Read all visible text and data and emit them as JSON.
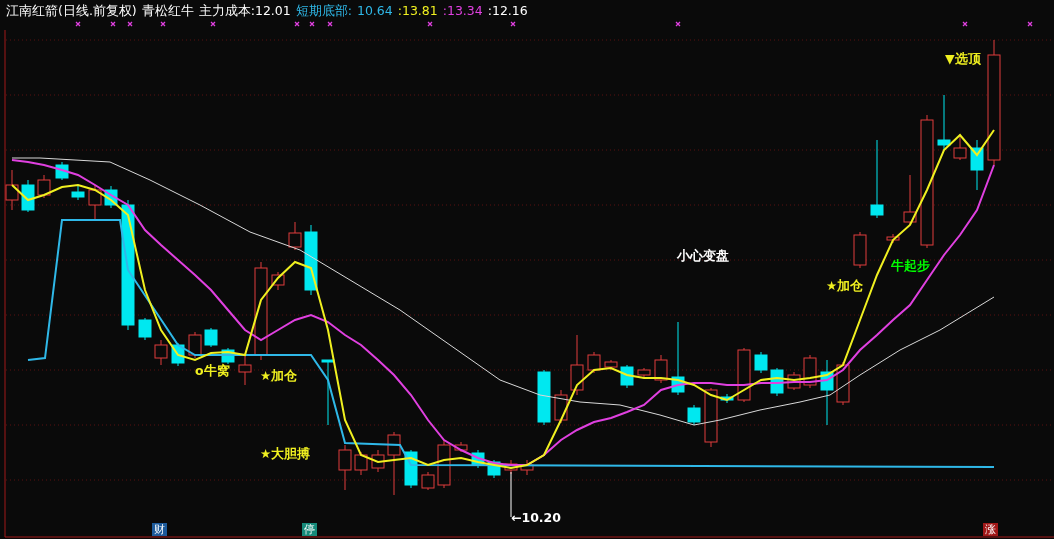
{
  "header": {
    "items": [
      {
        "text": "江南红箭(日线.前复权)",
        "color": "#ffffff"
      },
      {
        "text": "青松红牛",
        "color": "#ffffff"
      },
      {
        "text": "主力成本:12.01",
        "color": "#ffffff"
      },
      {
        "text": "短期底部:",
        "color": "#2fb8e8"
      },
      {
        "text": "10.64",
        "color": "#2fb8e8"
      },
      {
        "text": ":13.81",
        "color": "#f0f020"
      },
      {
        "text": ":13.34",
        "color": "#e040e0"
      },
      {
        "text": ":12.16",
        "color": "#ffffff"
      }
    ]
  },
  "annotations": [
    {
      "text": "o牛窝",
      "color": "#f0f020"
    },
    {
      "text": "★加仓",
      "color": "#f0f020"
    },
    {
      "text": "★大胆搏",
      "color": "#f0f020"
    },
    {
      "text": "小心变盘",
      "color": "#ffffff"
    },
    {
      "text": "★加仓",
      "color": "#f0f020"
    },
    {
      "text": "牛起步",
      "color": "#00ff00"
    },
    {
      "text": "▼选顶",
      "color": "#f0f020"
    },
    {
      "text": "←10.20",
      "color": "#ffffff"
    }
  ],
  "badges": [
    {
      "text": "财",
      "color": "#1d5a9a"
    },
    {
      "text": "停",
      "color": "#168a7a"
    },
    {
      "text": "涨",
      "color": "#a01818"
    }
  ]
}
